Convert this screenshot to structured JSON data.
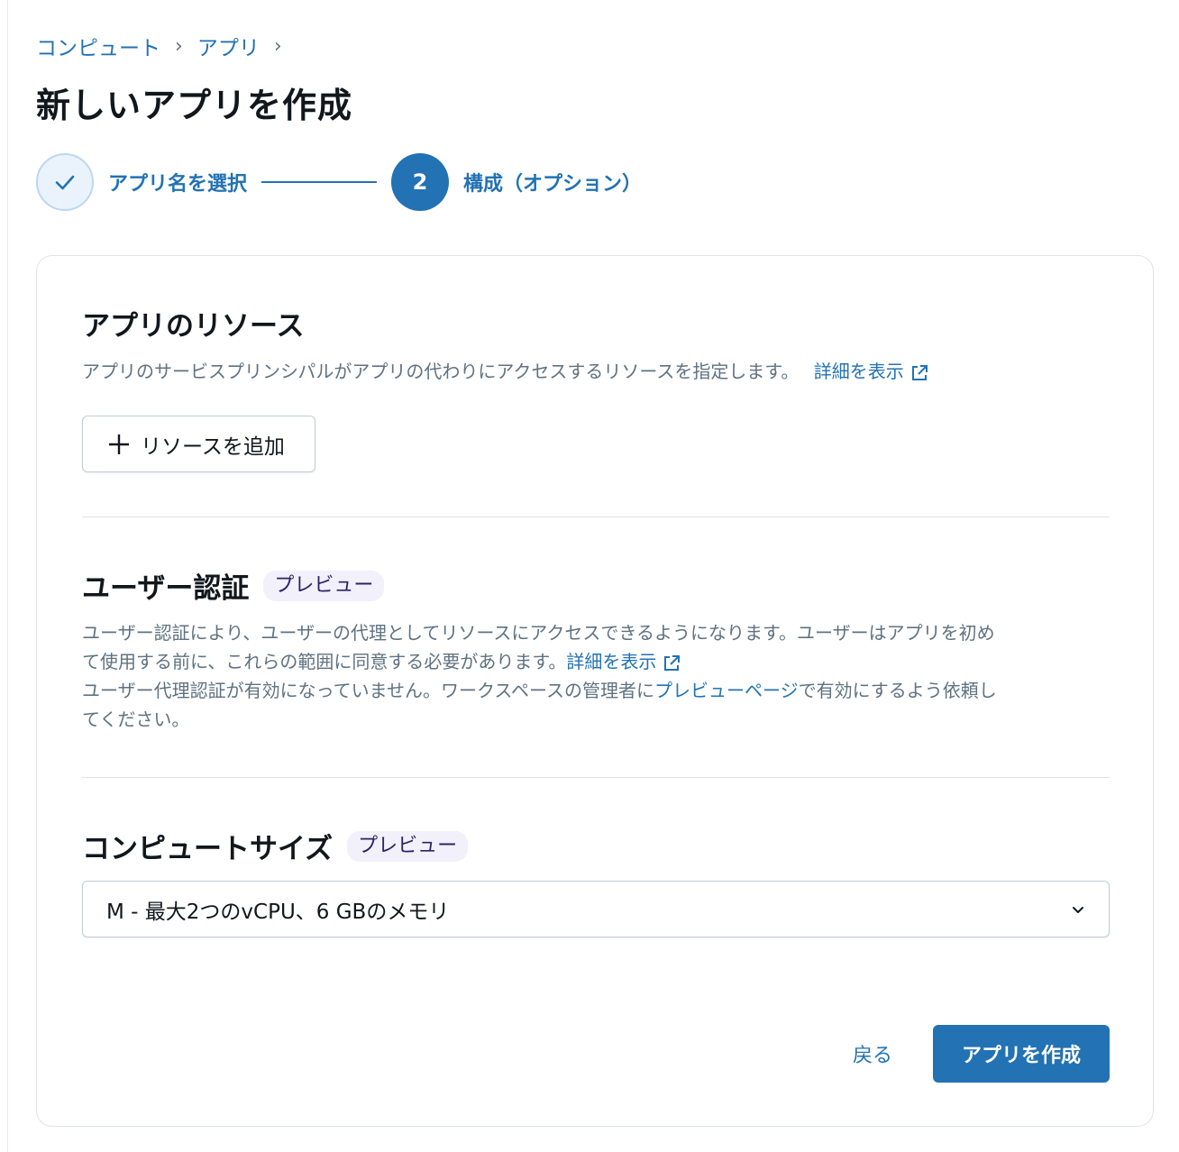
{
  "breadcrumb": {
    "items": [
      "コンピュート",
      "アプリ"
    ],
    "separator": "›"
  },
  "page": {
    "title": "新しいアプリを作成"
  },
  "stepper": {
    "steps": [
      {
        "label": "アプリ名を選択",
        "state": "completed",
        "icon": "check-icon"
      },
      {
        "number": "2",
        "label": "構成（オプション）",
        "state": "active"
      }
    ]
  },
  "resources": {
    "title": "アプリのリソース",
    "description": "アプリのサービスプリンシパルがアプリの代わりにアクセスするリソースを指定します。",
    "learn_more": "詳細を表示",
    "add_button": "リソースを追加"
  },
  "user_auth": {
    "title": "ユーザー認証",
    "badge": "プレビュー",
    "desc_line1": "ユーザー認証により、ユーザーの代理としてリソースにアクセスできるようになります。ユーザーはアプリを初め",
    "desc_line2": "て使用する前に、これらの範囲に同意する必要があります。",
    "learn_more": "詳細を表示",
    "disabled_prefix": "ユーザー代理認証が有効になっていません。ワークスペースの管理者に",
    "preview_link": "プレビューページ",
    "disabled_suffix_line1": "で有効にするよう依頼し",
    "disabled_suffix_line2": "てください。"
  },
  "compute_size": {
    "title": "コンピュートサイズ",
    "badge": "プレビュー",
    "selected": "M - 最大2つのvCPU、6 GBのメモリ"
  },
  "footer": {
    "back": "戻る",
    "create": "アプリを作成"
  },
  "colors": {
    "accent": "#2272b4",
    "badge_bg": "#f2f0fb",
    "muted_text": "#5f7281",
    "border": "#dfe3e7"
  }
}
